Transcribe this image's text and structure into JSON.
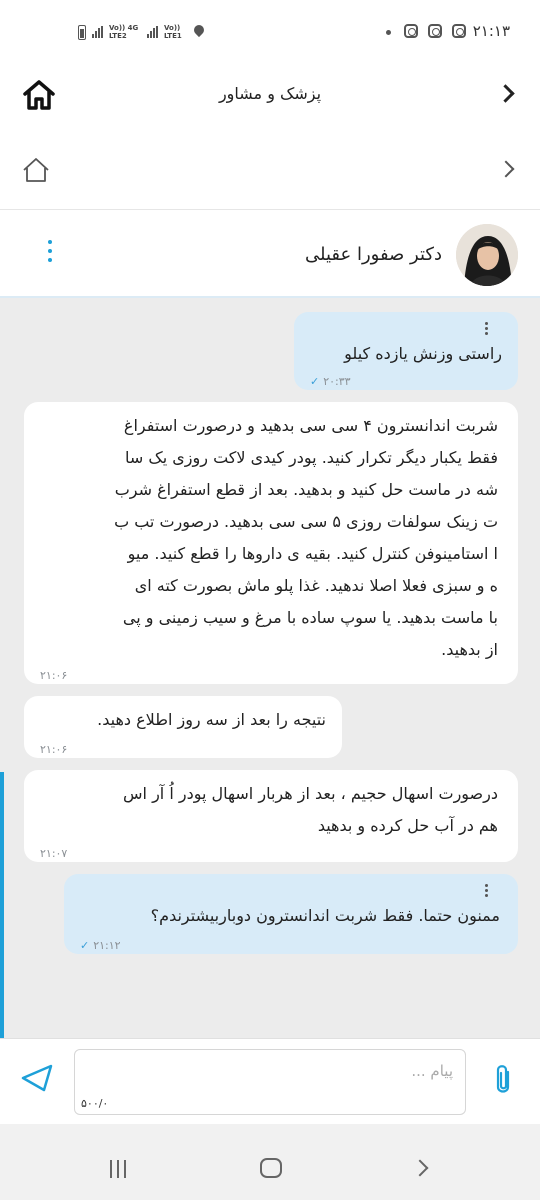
{
  "status_bar": {
    "clock": "۲۱:۱۳",
    "network_1": "Vo)) 4G LTE2",
    "network_2": "Vo)) LTE1"
  },
  "header": {
    "title": "پزشک و مشاور"
  },
  "chat": {
    "doctor_name": "دکتر صفورا عقیلی",
    "messages": [
      {
        "direction": "out",
        "text": "راستی وزنش یازده کیلو",
        "time": "۲۰:۳۳"
      },
      {
        "direction": "in",
        "text": "شربت اندانسترون ۴ سی سی بدهید و درصورت استفراغ\nفقط یکبار دیگر تکرار کنید. پودر کیدی لاکت روزی یک سا\nشه در ماست حل کنید و بدهید. بعد از قطع استفراغ شرب\nت زینک سولفات روزی ۵ سی سی بدهید. درصورت تب ب\nا استامینوفن کنترل کنید. بقیه ی داروها را قطع کنید. میو\nه و سبزی فعلا اصلا ندهید. غذا پلو ماش بصورت کته ای\nبا ماست بدهید. یا سوپ ساده با مرغ و سیب زمینی و پی\nاز بدهید.",
        "time": "۲۱:۰۶"
      },
      {
        "direction": "in",
        "text": "نتیجه را بعد از سه روز اطلاع دهید.",
        "time": "۲۱:۰۶"
      },
      {
        "direction": "in",
        "text": "درصورت اسهال حجیم ، بعد از هربار اسهال پودر اُ آر اس\nهم در آب حل کرده و بدهید",
        "time": "۲۱:۰۷"
      },
      {
        "direction": "out",
        "text": "ممنون حتما. فقط شربت اندانسترون دوباربیشترندم؟",
        "time": "۲۱:۱۲"
      }
    ]
  },
  "composer": {
    "placeholder": "پیام ...",
    "counter": "۵۰۰/۰"
  },
  "colors": {
    "accent": "#1ea0d8",
    "outgoing_bubble": "#d8ebf8",
    "incoming_bubble": "#ffffff",
    "chat_background": "#ececec"
  }
}
